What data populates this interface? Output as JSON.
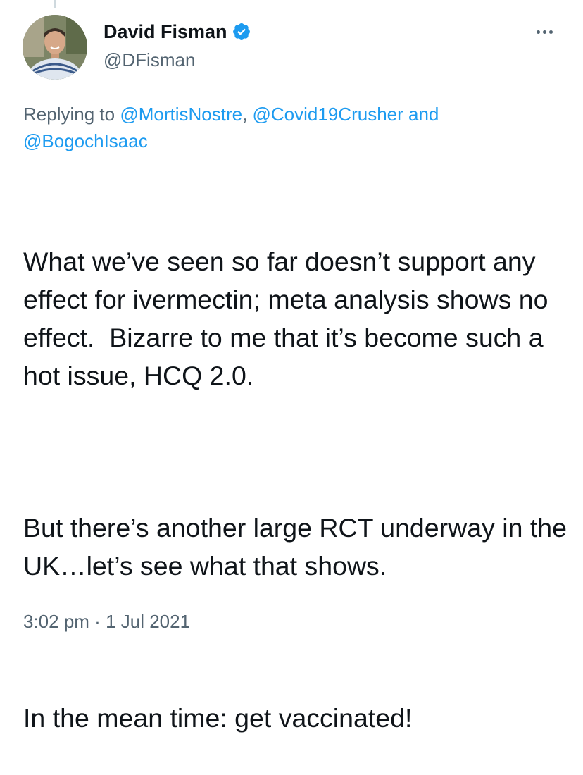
{
  "tweet": {
    "author": {
      "display_name": "David Fisman",
      "handle": "@DFisman",
      "verified": true,
      "verified_color": "#1d9bf0"
    },
    "reply": {
      "prefix": "Replying to ",
      "mention_1": "@MortisNostre",
      "separator_1": ", ",
      "mention_2": "@Covid19Crusher",
      "separator_2": " and ",
      "mention_3": "@BogochIsaac"
    },
    "body": {
      "paragraph_1": "What we’ve seen so far doesn’t support any effect for ivermectin; meta analysis shows no effect.  Bizarre to me that it’s become such a hot issue, HCQ 2.0.",
      "paragraph_2": "But there’s another large RCT underway in the UK…let’s see what that shows.",
      "paragraph_3": "In the mean time: get vaccinated!"
    },
    "time": "3:02 pm",
    "dot": " · ",
    "date": "1 Jul 2021"
  },
  "colors": {
    "text": "#0f1419",
    "secondary": "#536471",
    "link": "#1d9bf0",
    "thread_line": "#cfd9de"
  },
  "icons": {
    "verified": "verified-badge-icon",
    "more": "more-horizontal-icon"
  }
}
